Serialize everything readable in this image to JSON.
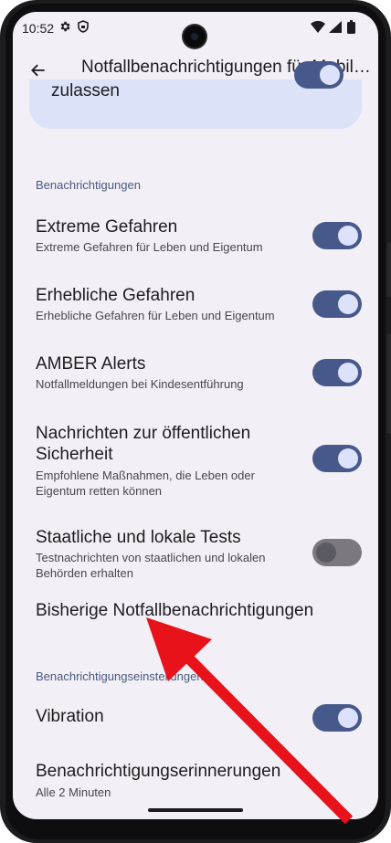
{
  "status": {
    "time": "10:52"
  },
  "appbar": {
    "title": "Notfallbenachrichtigungen für Mobilgeräte"
  },
  "top_card": {
    "label": "zulassen"
  },
  "sections": {
    "notifications_header": "Benachrichtigungen",
    "settings_header": "Benachrichtigungseinstellungen"
  },
  "items": [
    {
      "title": "Extreme Gefahren",
      "subtitle": "Extreme Gefahren für Leben und Eigentum",
      "enabled": true
    },
    {
      "title": "Erhebliche Gefahren",
      "subtitle": "Erhebliche Gefahren für Leben und Eigentum",
      "enabled": true
    },
    {
      "title": "AMBER Alerts",
      "subtitle": "Notfallmeldungen bei Kindesentführung",
      "enabled": true
    },
    {
      "title": "Nachrichten zur öffentlichen Sicherheit",
      "subtitle": "Empfohlene Maßnahmen, die Leben oder Eigentum retten können",
      "enabled": true
    },
    {
      "title": "Staatliche und lokale Tests",
      "subtitle": "Testnachrichten von staatlichen und lokalen Behörden erhalten",
      "enabled": false
    }
  ],
  "history": {
    "title": "Bisherige Notfallbenachrichtigungen"
  },
  "vibration": {
    "title": "Vibration",
    "enabled": true
  },
  "reminders": {
    "title": "Benachrichtigungserinnerungen",
    "subtitle": "Alle 2 Minuten"
  },
  "colors": {
    "accent": "#46598a",
    "annotation_arrow": "#e8121b",
    "background": "#f3eff6"
  },
  "icons": [
    "settings-gear-icon",
    "shield-icon",
    "wifi-icon",
    "battery-icon",
    "back-arrow-icon"
  ]
}
